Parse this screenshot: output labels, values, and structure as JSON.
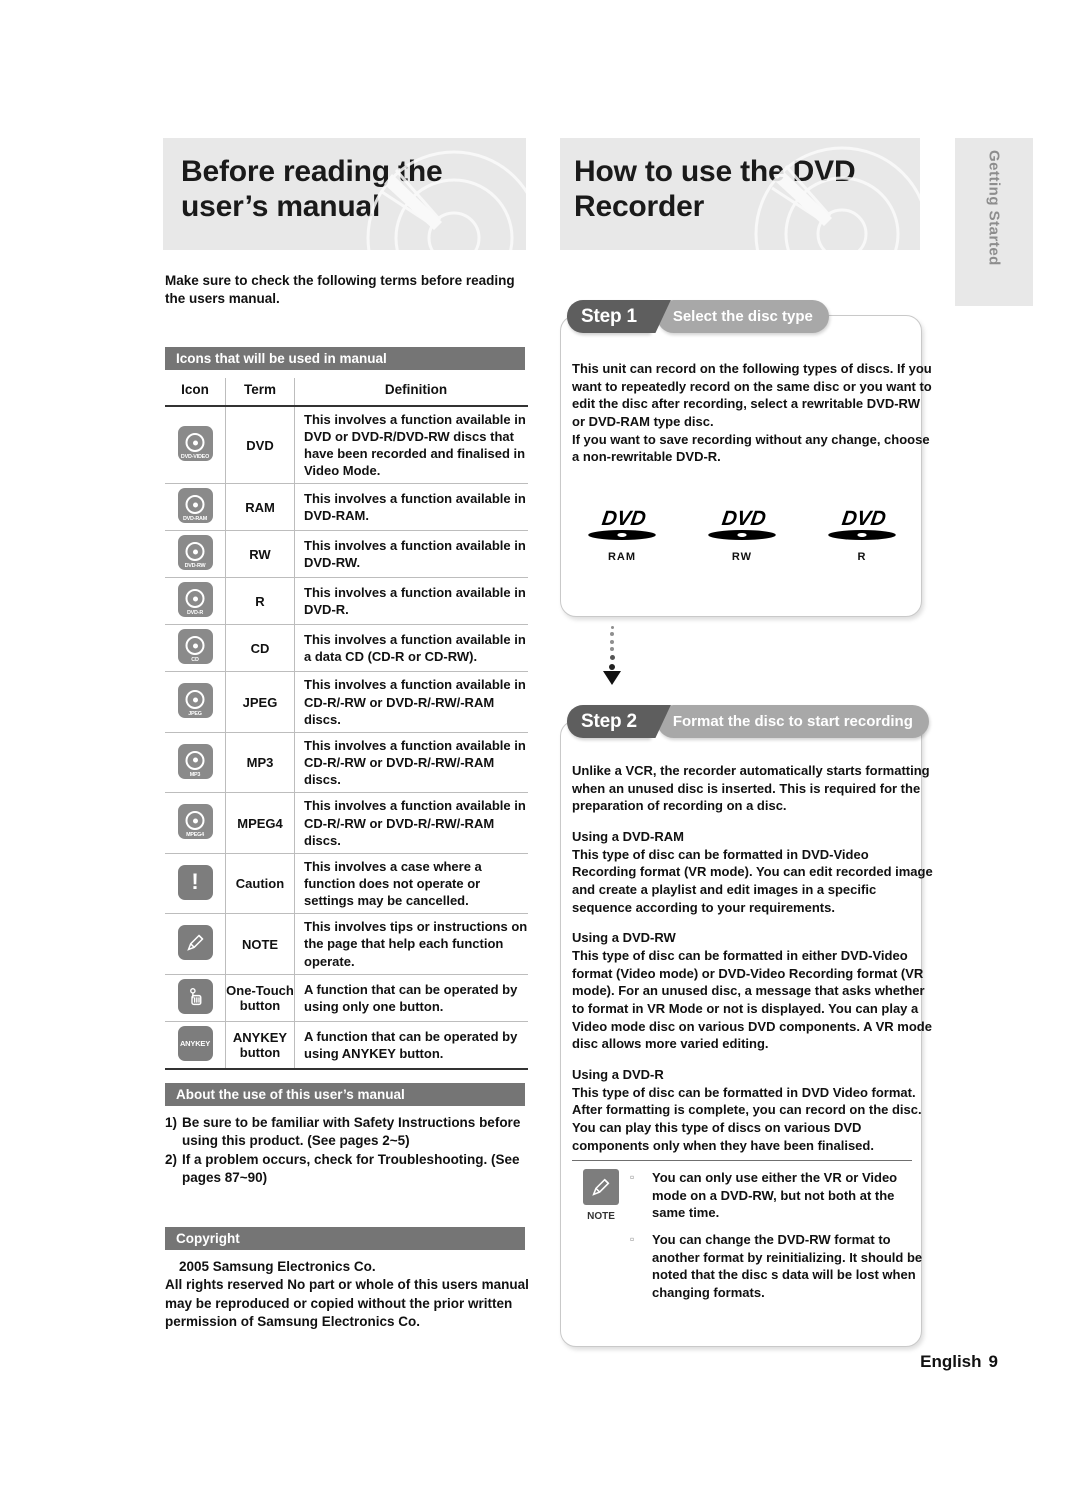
{
  "headings": {
    "left": "Before reading the user’s manual",
    "right": "How to use the DVD Recorder",
    "side_tab": "Getting Started"
  },
  "left_column": {
    "intro": "Make sure to check the following terms before reading the users manual.",
    "icons_bar": "Icons that will be used in manual",
    "table": {
      "headers": [
        "Icon",
        "Term",
        "Definition"
      ],
      "rows": [
        {
          "icon": "dvd-video-disc-icon",
          "icon_label": "DVD-VIDEO",
          "term": "DVD",
          "definition": "This involves a function available in DVD or DVD-R/DVD-RW discs that have been recorded and finalised in Video Mode."
        },
        {
          "icon": "dvd-ram-disc-icon",
          "icon_label": "DVD-RAM",
          "term": "RAM",
          "definition": "This involves a function available in DVD-RAM."
        },
        {
          "icon": "dvd-rw-disc-icon",
          "icon_label": "DVD-RW",
          "term": "RW",
          "definition": "This involves a function available in DVD-RW."
        },
        {
          "icon": "dvd-r-disc-icon",
          "icon_label": "DVD-R",
          "term": "R",
          "definition": "This involves a function available in DVD-R."
        },
        {
          "icon": "cd-disc-icon",
          "icon_label": "CD",
          "term": "CD",
          "definition": "This involves a function available in a data CD (CD-R or CD-RW)."
        },
        {
          "icon": "jpeg-disc-icon",
          "icon_label": "JPEG",
          "term": "JPEG",
          "definition": "This involves a function available in CD-R/-RW or DVD-R/-RW/-RAM discs."
        },
        {
          "icon": "mp3-disc-icon",
          "icon_label": "MP3",
          "term": "MP3",
          "definition": "This involves a function available in CD-R/-RW or DVD-R/-RW/-RAM discs."
        },
        {
          "icon": "mpeg4-disc-icon",
          "icon_label": "MPEG4",
          "term": "MPEG4",
          "definition": "This involves a function available in CD-R/-RW or DVD-R/-RW/-RAM discs."
        },
        {
          "icon": "caution-exclamation-icon",
          "icon_label": "!",
          "term": "Caution",
          "definition": "This involves a case where a function does not operate or settings may be cancelled."
        },
        {
          "icon": "note-pencil-icon",
          "icon_label": "",
          "term": "NOTE",
          "definition": "This involves tips or instructions on the page that help each function operate."
        },
        {
          "icon": "one-touch-hand-icon",
          "icon_label": "",
          "term": "One-Touch button",
          "definition": "A function that can be operated by using only one button."
        },
        {
          "icon": "anykey-button-icon",
          "icon_label": "ANYKEY",
          "term": "ANYKEY button",
          "definition": "A function that can be operated by using ANYKEY button."
        }
      ]
    },
    "about_bar": "About the use of this user’s manual",
    "about_items": [
      {
        "num": "1)",
        "text": "Be sure to be familiar with Safety Instructions before using this product. (See pages 2~5)"
      },
      {
        "num": "2)",
        "text": "If a problem occurs, check for Troubleshooting. (See pages 87~90)"
      }
    ],
    "copyright_bar": "Copyright",
    "copyright_line1": "2005 Samsung Electronics Co.",
    "copyright_line2": "All rights reserved  No part or whole of this users manual may be reproduced or copied without the prior written permission of Samsung Electronics Co."
  },
  "right_column": {
    "step1": {
      "label": "Step 1",
      "title": "Select the disc type",
      "body": [
        "This unit can record on the following types of discs. If you want to repeatedly record on the same disc or you want to edit the disc after recording, select a rewritable DVD-RW or DVD-RAM type disc.",
        "If you want to save recording without any change, choose a non-rewritable DVD-R."
      ],
      "logos": [
        {
          "wordmark": "DVD",
          "sub": "RAM"
        },
        {
          "wordmark": "DVD",
          "sub": "RW"
        },
        {
          "wordmark": "DVD",
          "sub": "R"
        }
      ]
    },
    "step2": {
      "label": "Step 2",
      "title": "Format the disc to start recording",
      "intro": "Unlike a VCR, the recorder automatically starts formatting when an unused disc is inserted. This is required for the preparation of recording on a disc.",
      "sections": [
        {
          "heading": "Using a DVD-RAM",
          "text": "This type of disc can be formatted in DVD-Video Recording format (VR mode). You can edit recorded image and create a playlist and edit images in a specific sequence according to your requirements."
        },
        {
          "heading": "Using a DVD-RW",
          "text": "This type of disc can be formatted in either DVD-Video format (Video mode) or DVD-Video Recording format (VR mode). For an unused disc, a message that asks whether to format in VR Mode or not is displayed. You can play a Video mode disc on various DVD components. A VR mode disc allows more varied editing."
        },
        {
          "heading": "Using a DVD-R",
          "text": "This type of disc can be formatted in DVD Video format. After formatting is complete, you can record on the disc. You can play this type of discs on various DVD components only when they have been finalised."
        }
      ],
      "note": {
        "badge_label": "NOTE",
        "items": [
          "You can only use either the VR or Video mode on a DVD-RW, but not both at the same time.",
          "You can change the DVD-RW format to another format by reinitializing. It should be noted that the disc s data will be lost when changing formats."
        ]
      }
    }
  },
  "footer": {
    "language": "English",
    "page_number": "9"
  },
  "colors": {
    "bar_gray": "#757575",
    "banner_gray": "#e8e8e8",
    "step_label_gray": "#5e5e5e",
    "step_title_gray": "#a8a8a8",
    "icon_tile_gray": "#8a8a8a"
  }
}
